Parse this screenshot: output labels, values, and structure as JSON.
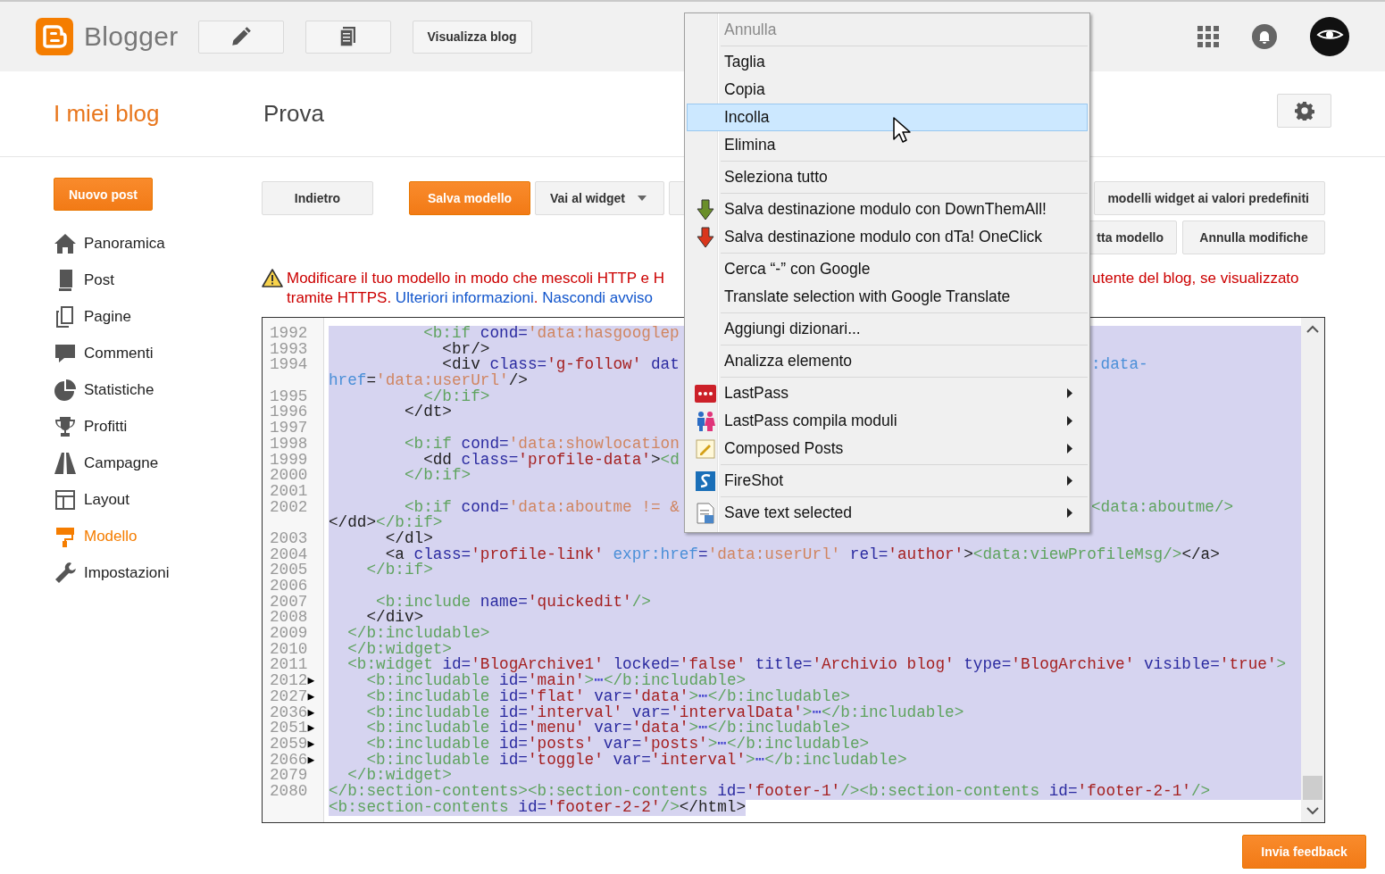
{
  "header": {
    "logo_text": "Blogger",
    "view_blog_button": "Visualizza blog"
  },
  "blog_bar": {
    "my_blogs_link": "I miei blog",
    "blog_title": "Prova"
  },
  "sidebar": {
    "new_post_button": "Nuovo post",
    "items": [
      {
        "label": "Panoramica",
        "kind": "home",
        "selected": false
      },
      {
        "label": "Post",
        "kind": "post",
        "selected": false
      },
      {
        "label": "Pagine",
        "kind": "pages",
        "selected": false
      },
      {
        "label": "Commenti",
        "kind": "comments",
        "selected": false
      },
      {
        "label": "Statistiche",
        "kind": "stats",
        "selected": false
      },
      {
        "label": "Profitti",
        "kind": "trophy",
        "selected": false
      },
      {
        "label": "Campagne",
        "kind": "road",
        "selected": false
      },
      {
        "label": "Layout",
        "kind": "layout",
        "selected": false
      },
      {
        "label": "Modello",
        "kind": "template",
        "selected": true
      },
      {
        "label": "Impostazioni",
        "kind": "wrench",
        "selected": false
      }
    ]
  },
  "toolbar": {
    "row1_left": [
      {
        "label": "Indietro",
        "kind": "default"
      },
      {
        "label": "Salva modello",
        "kind": "primary"
      },
      {
        "label": "Vai al widget",
        "kind": "dropdown"
      },
      {
        "kind": "blank"
      }
    ],
    "row1_right": [
      "modelli widget ai valori predefiniti"
    ],
    "row2_right": [
      "tta modello",
      "Annulla modifiche"
    ]
  },
  "warning": {
    "line1_start": "Modificare il tuo modello in modo che mescoli HTTP e H",
    "line1_end": "utente del blog, se visualizzato",
    "line2": [
      {
        "kind": "text",
        "text": "tramite HTTPS. "
      },
      {
        "kind": "link",
        "text": "Ulteriori informazioni"
      },
      {
        "kind": "text",
        "text": ". "
      },
      {
        "kind": "link",
        "text": "Nascondi avviso"
      }
    ]
  },
  "editor": {
    "all_selected": true,
    "lines": [
      {
        "n": "1992",
        "code": [
          {
            "kind": "tag",
            "text": "          <b:if"
          },
          {
            "kind": "attr",
            "text": " cond="
          },
          {
            "kind": "expr",
            "text": "'data:hasgooglep"
          }
        ]
      },
      {
        "n": "1993",
        "code": [
          {
            "kind": "html",
            "text": "            <br/>"
          }
        ]
      },
      {
        "n": "1994",
        "code": [
          {
            "kind": "html",
            "text": "            <div"
          },
          {
            "kind": "attr",
            "text": " class="
          },
          {
            "kind": "str",
            "text": "'g-follow'"
          },
          {
            "kind": "attr",
            "text": " dat"
          }
        ],
        "tail": [
          {
            "kind": "link",
            "text": ":data-"
          }
        ]
      },
      {
        "code": [
          {
            "kind": "link",
            "text": "href"
          },
          {
            "kind": "html",
            "text": "="
          },
          {
            "kind": "expr",
            "text": "'data:userUrl'"
          },
          {
            "kind": "html",
            "text": "/>"
          }
        ]
      },
      {
        "n": "1995",
        "code": [
          {
            "kind": "tag",
            "text": "          </b:if>"
          }
        ]
      },
      {
        "n": "1996",
        "code": [
          {
            "kind": "html",
            "text": "        </dt>"
          }
        ]
      },
      {
        "n": "1997"
      },
      {
        "n": "1998",
        "code": [
          {
            "kind": "tag",
            "text": "        <b:if"
          },
          {
            "kind": "attr",
            "text": " cond="
          },
          {
            "kind": "expr",
            "text": "'data:showlocation"
          }
        ]
      },
      {
        "n": "1999",
        "code": [
          {
            "kind": "html",
            "text": "          <dd"
          },
          {
            "kind": "attr",
            "text": " class="
          },
          {
            "kind": "str",
            "text": "'profile-data'"
          },
          {
            "kind": "html",
            "text": ">"
          },
          {
            "kind": "tag",
            "text": "<d"
          }
        ]
      },
      {
        "n": "2000",
        "code": [
          {
            "kind": "tag",
            "text": "        </b:if>"
          }
        ]
      },
      {
        "n": "2001"
      },
      {
        "n": "2002",
        "code": [
          {
            "kind": "tag",
            "text": "        <b:if"
          },
          {
            "kind": "attr",
            "text": " cond="
          },
          {
            "kind": "expr",
            "text": "'data:aboutme != &"
          }
        ],
        "tail": [
          {
            "kind": "tag",
            "text": "<data:aboutme/>"
          }
        ]
      },
      {
        "code": [
          {
            "kind": "html",
            "text": "</dd>"
          },
          {
            "kind": "tag",
            "text": "</b:if>"
          }
        ]
      },
      {
        "n": "2003",
        "code": [
          {
            "kind": "html",
            "text": "      </dl>"
          }
        ]
      },
      {
        "n": "2004",
        "code": [
          {
            "kind": "html",
            "text": "      <a"
          },
          {
            "kind": "attr",
            "text": " class="
          },
          {
            "kind": "str",
            "text": "'profile-link'"
          },
          {
            "kind": "link",
            "text": " expr:href"
          },
          {
            "kind": "attr",
            "text": "="
          },
          {
            "kind": "expr",
            "text": "'data:userUrl'"
          },
          {
            "kind": "attr",
            "text": " rel="
          },
          {
            "kind": "str",
            "text": "'author'"
          },
          {
            "kind": "html",
            "text": ">"
          },
          {
            "kind": "tag",
            "text": "<data:viewProfileMsg/>"
          },
          {
            "kind": "html",
            "text": "</a>"
          }
        ]
      },
      {
        "n": "2005",
        "code": [
          {
            "kind": "tag",
            "text": "    </b:if>"
          }
        ]
      },
      {
        "n": "2006"
      },
      {
        "n": "2007",
        "code": [
          {
            "kind": "tag",
            "text": "     <b:include"
          },
          {
            "kind": "attr",
            "text": " name="
          },
          {
            "kind": "str",
            "text": "'quickedit'"
          },
          {
            "kind": "tag",
            "text": "/>"
          }
        ]
      },
      {
        "n": "2008",
        "code": [
          {
            "kind": "html",
            "text": "    </div>"
          }
        ]
      },
      {
        "n": "2009",
        "code": [
          {
            "kind": "tag",
            "text": "  </b:includable>"
          }
        ]
      },
      {
        "n": "2010",
        "code": [
          {
            "kind": "tag",
            "text": "  </b:widget>"
          }
        ]
      },
      {
        "n": "2011",
        "code": [
          {
            "kind": "tag",
            "text": "  <b:widget"
          },
          {
            "kind": "attr",
            "text": " id="
          },
          {
            "kind": "str",
            "text": "'BlogArchive1'"
          },
          {
            "kind": "attr",
            "text": " locked="
          },
          {
            "kind": "str",
            "text": "'false'"
          },
          {
            "kind": "attr",
            "text": " title="
          },
          {
            "kind": "str",
            "text": "'Archivio blog'"
          },
          {
            "kind": "attr",
            "text": " type="
          },
          {
            "kind": "str",
            "text": "'BlogArchive'"
          },
          {
            "kind": "attr",
            "text": " visible="
          },
          {
            "kind": "str",
            "text": "'true'"
          },
          {
            "kind": "tag",
            "text": ">"
          }
        ]
      },
      {
        "n": "2012",
        "marker": "▶",
        "code": [
          {
            "kind": "tag",
            "text": "    <b:includable"
          },
          {
            "kind": "attr",
            "text": " id="
          },
          {
            "kind": "str",
            "text": "'main'"
          },
          {
            "kind": "tag",
            "text": ">"
          },
          {
            "kind": "fold",
            "text": "⋯"
          },
          {
            "kind": "tag",
            "text": "</b:includable>"
          }
        ]
      },
      {
        "n": "2027",
        "marker": "▶",
        "code": [
          {
            "kind": "tag",
            "text": "    <b:includable"
          },
          {
            "kind": "attr",
            "text": " id="
          },
          {
            "kind": "str",
            "text": "'flat'"
          },
          {
            "kind": "attr",
            "text": " var="
          },
          {
            "kind": "str",
            "text": "'data'"
          },
          {
            "kind": "tag",
            "text": ">"
          },
          {
            "kind": "fold",
            "text": "⋯"
          },
          {
            "kind": "tag",
            "text": "</b:includable>"
          }
        ]
      },
      {
        "n": "2036",
        "marker": "▶",
        "code": [
          {
            "kind": "tag",
            "text": "    <b:includable"
          },
          {
            "kind": "attr",
            "text": " id="
          },
          {
            "kind": "str",
            "text": "'interval'"
          },
          {
            "kind": "attr",
            "text": " var="
          },
          {
            "kind": "str",
            "text": "'intervalData'"
          },
          {
            "kind": "tag",
            "text": ">"
          },
          {
            "kind": "fold",
            "text": "⋯"
          },
          {
            "kind": "tag",
            "text": "</b:includable>"
          }
        ]
      },
      {
        "n": "2051",
        "marker": "▶",
        "code": [
          {
            "kind": "tag",
            "text": "    <b:includable"
          },
          {
            "kind": "attr",
            "text": " id="
          },
          {
            "kind": "str",
            "text": "'menu'"
          },
          {
            "kind": "attr",
            "text": " var="
          },
          {
            "kind": "str",
            "text": "'data'"
          },
          {
            "kind": "tag",
            "text": ">"
          },
          {
            "kind": "fold",
            "text": "⋯"
          },
          {
            "kind": "tag",
            "text": "</b:includable>"
          }
        ]
      },
      {
        "n": "2059",
        "marker": "▶",
        "code": [
          {
            "kind": "tag",
            "text": "    <b:includable"
          },
          {
            "kind": "attr",
            "text": " id="
          },
          {
            "kind": "str",
            "text": "'posts'"
          },
          {
            "kind": "attr",
            "text": " var="
          },
          {
            "kind": "str",
            "text": "'posts'"
          },
          {
            "kind": "tag",
            "text": ">"
          },
          {
            "kind": "fold",
            "text": "⋯"
          },
          {
            "kind": "tag",
            "text": "</b:includable>"
          }
        ]
      },
      {
        "n": "2066",
        "marker": "▶",
        "code": [
          {
            "kind": "tag",
            "text": "    <b:includable"
          },
          {
            "kind": "attr",
            "text": " id="
          },
          {
            "kind": "str",
            "text": "'toggle'"
          },
          {
            "kind": "attr",
            "text": " var="
          },
          {
            "kind": "str",
            "text": "'interval'"
          },
          {
            "kind": "tag",
            "text": ">"
          },
          {
            "kind": "fold",
            "text": "⋯"
          },
          {
            "kind": "tag",
            "text": "</b:includable>"
          }
        ]
      },
      {
        "n": "2079",
        "code": [
          {
            "kind": "tag",
            "text": "  </b:widget>"
          }
        ]
      },
      {
        "n": "2080",
        "code": [
          {
            "kind": "tag",
            "text": "</b:section-contents><b:section-contents"
          },
          {
            "kind": "attr",
            "text": " id="
          },
          {
            "kind": "str",
            "text": "'footer-1'"
          },
          {
            "kind": "tag",
            "text": "/><b:section-contents"
          },
          {
            "kind": "attr",
            "text": " id="
          },
          {
            "kind": "str",
            "text": "'footer-2-1'"
          },
          {
            "kind": "tag",
            "text": "/>"
          }
        ]
      },
      {
        "code": [
          {
            "kind": "tag",
            "text": "<b:section-contents"
          },
          {
            "kind": "attr",
            "text": " id="
          },
          {
            "kind": "str",
            "text": "'footer-2-2'"
          },
          {
            "kind": "tag",
            "text": "/>"
          },
          {
            "kind": "html",
            "text": "</html>"
          }
        ]
      }
    ]
  },
  "context_menu": {
    "items": [
      {
        "kind": "text",
        "label": "Annulla",
        "disabled": true,
        "selected": false,
        "submenu": false
      },
      {
        "kind": "separator"
      },
      {
        "kind": "text",
        "label": "Taglia",
        "disabled": false,
        "selected": false,
        "submenu": false
      },
      {
        "kind": "text",
        "label": "Copia",
        "disabled": false,
        "selected": false,
        "submenu": false
      },
      {
        "kind": "text",
        "label": "Incolla",
        "disabled": false,
        "selected": true,
        "submenu": false
      },
      {
        "kind": "text",
        "label": "Elimina",
        "disabled": false,
        "selected": false,
        "submenu": false
      },
      {
        "kind": "separator"
      },
      {
        "kind": "text",
        "label": "Seleziona tutto",
        "disabled": false,
        "selected": false,
        "submenu": false
      },
      {
        "kind": "separator"
      },
      {
        "kind": "download-green",
        "label": "Salva destinazione modulo con DownThemAll!",
        "disabled": false,
        "selected": false,
        "submenu": false
      },
      {
        "kind": "download-red",
        "label": "Salva destinazione modulo con dTa! OneClick",
        "disabled": false,
        "selected": false,
        "submenu": false
      },
      {
        "kind": "separator"
      },
      {
        "kind": "text",
        "label": "Cerca “-” con Google",
        "disabled": false,
        "selected": false,
        "submenu": false
      },
      {
        "kind": "text",
        "label": "Translate selection with Google Translate",
        "disabled": false,
        "selected": false,
        "submenu": false
      },
      {
        "kind": "separator"
      },
      {
        "kind": "text",
        "label": "Aggiungi dizionari...",
        "disabled": false,
        "selected": false,
        "submenu": false
      },
      {
        "kind": "separator"
      },
      {
        "kind": "text",
        "label": "Analizza elemento",
        "disabled": false,
        "selected": false,
        "submenu": false
      },
      {
        "kind": "separator"
      },
      {
        "kind": "dots",
        "label": "LastPass",
        "disabled": false,
        "selected": false,
        "submenu": true
      },
      {
        "kind": "people",
        "label": "LastPass compila moduli",
        "disabled": false,
        "selected": false,
        "submenu": true
      },
      {
        "kind": "note",
        "label": "Composed Posts",
        "disabled": false,
        "selected": false,
        "submenu": true
      },
      {
        "kind": "separator"
      },
      {
        "kind": "swirl",
        "label": "FireShot",
        "disabled": false,
        "selected": false,
        "submenu": true
      },
      {
        "kind": "separator"
      },
      {
        "kind": "document",
        "label": "Save text selected",
        "disabled": false,
        "selected": false,
        "submenu": true
      }
    ]
  },
  "feedback_button": "Invia feedback"
}
